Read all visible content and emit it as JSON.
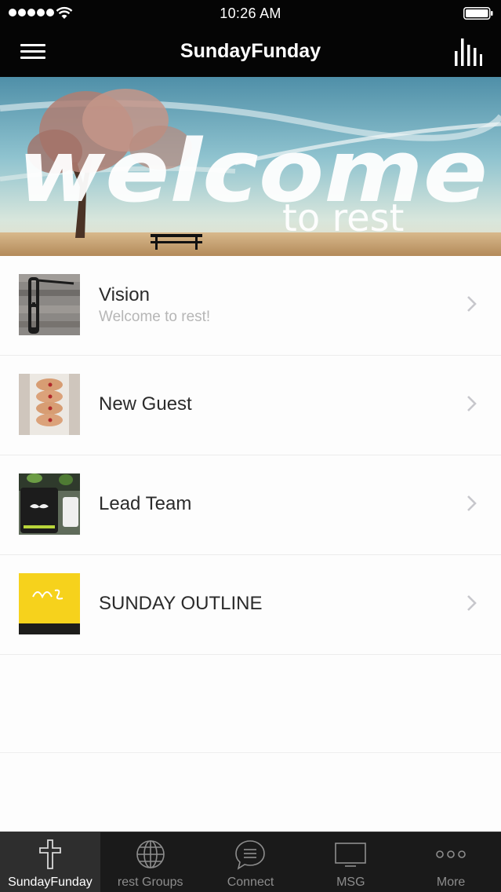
{
  "status_bar": {
    "time": "10:26 AM"
  },
  "nav": {
    "title": "SundayFunday"
  },
  "list": {
    "items": [
      {
        "title": "Vision",
        "subtitle": "Welcome to rest!"
      },
      {
        "title": "New Guest"
      },
      {
        "title": "Lead Team"
      },
      {
        "title": "SUNDAY OUTLINE"
      }
    ]
  },
  "tabs": [
    {
      "label": "SundayFunday",
      "icon": "cross-icon"
    },
    {
      "label": "rest Groups",
      "icon": "globe-icon"
    },
    {
      "label": "Connect",
      "icon": "chat-bubble-icon"
    },
    {
      "label": "MSG",
      "icon": "monitor-icon"
    },
    {
      "label": "More",
      "icon": "more-dots-icon"
    }
  ],
  "colors": {
    "bar_background": "#050505",
    "tab_bar_background": "#1a1a1a",
    "title_text": "#2b2b2b",
    "subtitle_text": "#b6b6b6"
  }
}
